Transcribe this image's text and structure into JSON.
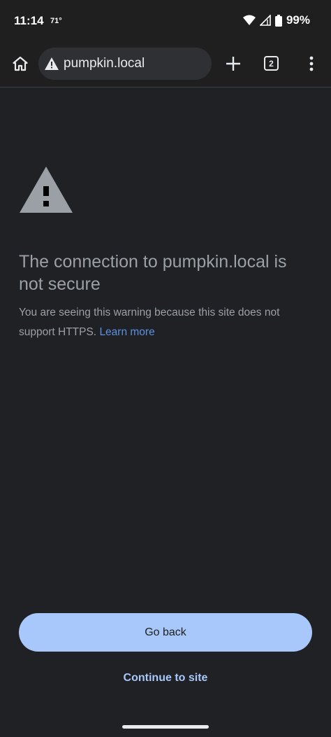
{
  "status_bar": {
    "time": "11:14",
    "temperature": "71°",
    "battery": "99%",
    "icons": [
      "wifi-icon",
      "signal-icon",
      "battery-icon"
    ]
  },
  "toolbar": {
    "url": "pumpkin.local",
    "tab_count": "2",
    "icons": [
      "home-icon",
      "warning-icon",
      "plus-icon",
      "more-vert-icon"
    ]
  },
  "interstitial": {
    "icon": "warning-triangle-icon",
    "headline": "The connection to pumpkin.local is not secure",
    "explanation": "You are seeing this warning because this site does not support HTTPS.",
    "learn_more": "Learn more",
    "primary_button": "Go back",
    "secondary_link": "Continue to site"
  },
  "colors": {
    "background": "#202124",
    "primary_button": "#a8c7fa",
    "link": "#5b8fe0",
    "warning_icon": "#9aa0a6"
  }
}
